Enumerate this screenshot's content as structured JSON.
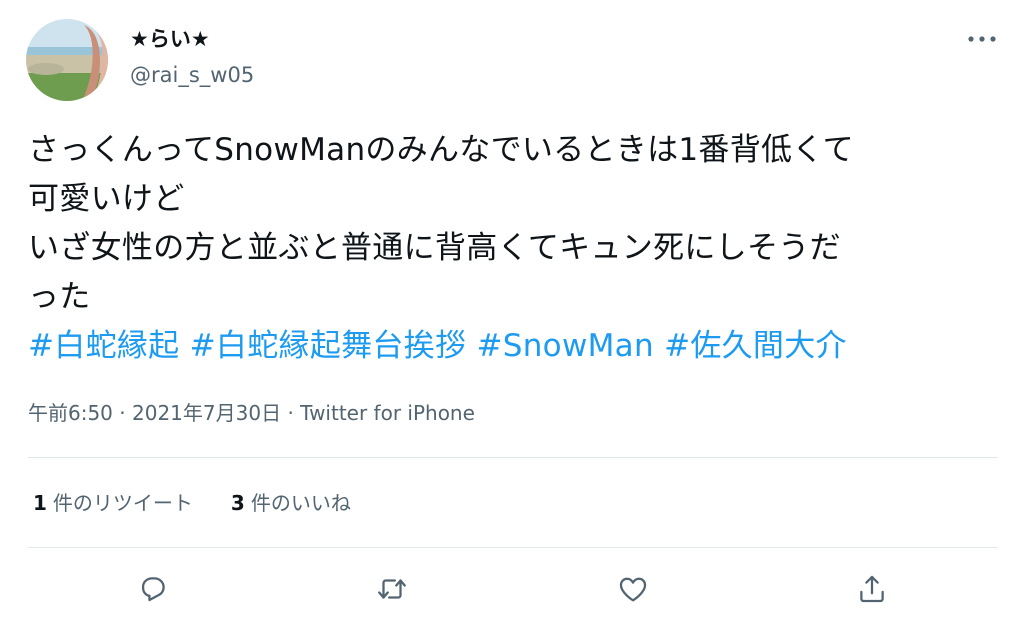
{
  "user": {
    "display_name": "★らい★",
    "handle": "@rai_s_w05"
  },
  "tweet": {
    "lines": [
      "さっくんってSnowManのみんなでいるときは1番背低くて",
      "可愛いけど",
      "いざ女性の方と並ぶと普通に背高くてキュン死にしそうだ",
      "った"
    ],
    "hashtags": [
      "#白蛇縁起",
      "#白蛇縁起舞台挨拶",
      "#SnowMan",
      "#佐久間大介"
    ]
  },
  "meta": {
    "time": "午前6:50",
    "separator_1": "·",
    "date": "2021年7月30日",
    "separator_2": "·",
    "source": "Twitter for iPhone"
  },
  "stats": {
    "retweets": {
      "count": "1",
      "label": "件のリツイート"
    },
    "likes": {
      "count": "3",
      "label": "件のいいね"
    }
  },
  "icons": {
    "more": "more-horizontal-icon",
    "reply": "reply-icon",
    "retweet": "retweet-icon",
    "like": "heart-icon",
    "share": "share-icon"
  },
  "colors": {
    "hashtag": "#1d9bf0",
    "text": "#0f1419",
    "secondary": "#536471",
    "divider": "#e1e8ed"
  }
}
